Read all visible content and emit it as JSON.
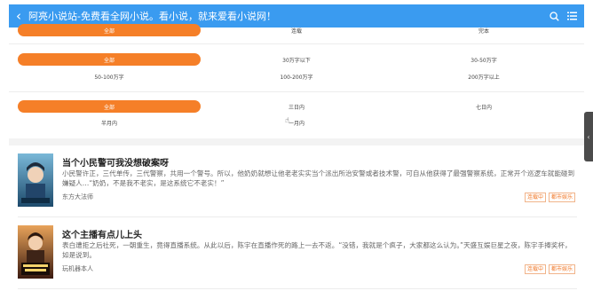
{
  "header": {
    "title": "阿亮小说站-免费看全网小说。看小说，就来爱看小说网！"
  },
  "filters": {
    "status": [
      "全部",
      "连载",
      "完本"
    ],
    "words_row1": [
      "全部",
      "30万字以下",
      "30-50万字"
    ],
    "words_row2": [
      "50-100万字",
      "100-200万字",
      "200万字以上"
    ],
    "update_row1": [
      "全部",
      "三日内",
      "七日内"
    ],
    "update_row2": [
      "半月内",
      "一月内"
    ]
  },
  "books": [
    {
      "title": "当个小民警可我没想破案呀",
      "desc": "小民警许正，三代单传，三代警察，共用一个警号。所以，他奶奶就想让他老老实实当个派出所治安警或者技术警，可自从他获得了最强警察系统，正常开个巡逻车就能碰到嫌疑人…“奶奶，不是我不老实，是这系统它不老实！”",
      "author": "东方大法师",
      "tags": [
        "连载中",
        "都市娱乐"
      ]
    },
    {
      "title": "这个主播有点儿上头",
      "desc": "表白遭拒之后社死，一朝重生，竟得直播系统。从此以后，陈宇在直播作死的路上一去不返。“没错，我就是个疯子，大家都这么认为。”天盛互娱巨星之夜，陈宇手捧奖杯，如是说到。",
      "author": "玩机器本人",
      "tags": [
        "连载中",
        "都市娱乐"
      ]
    }
  ],
  "colors": {
    "header": "#3a9bf0",
    "active_filter": "#f57f28",
    "tag": "#f1792a"
  }
}
